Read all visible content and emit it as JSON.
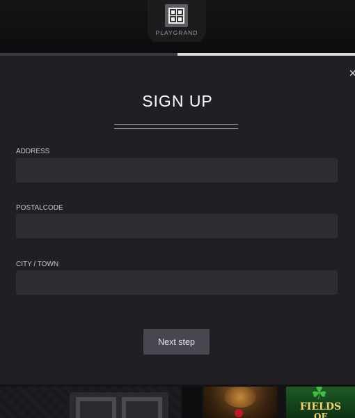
{
  "header": {
    "logo_text": "PLAYGRAND"
  },
  "progress": {
    "fraction": 0.5
  },
  "modal": {
    "close_glyph": "×",
    "title": "SIGN UP",
    "fields": [
      {
        "label": "ADDRESS",
        "value": "",
        "placeholder": ""
      },
      {
        "label": "POSTALCODE",
        "value": "",
        "placeholder": ""
      },
      {
        "label": "CITY / TOWN",
        "value": "",
        "placeholder": ""
      }
    ],
    "next_button": "Next step"
  },
  "background_tiles": {
    "fields_title": "FIELDS",
    "fields_sub": "OF"
  },
  "colors": {
    "modal_bg": "#221f24",
    "input_bg": "#2f2c32",
    "button_bg": "#4a4650",
    "progress_done": "#3b393e",
    "progress_remaining": "#d8d7da"
  },
  "icons": [
    "playgrand-logo-icon",
    "close-icon",
    "clover-icon",
    "roulette-wheel-icon"
  ]
}
